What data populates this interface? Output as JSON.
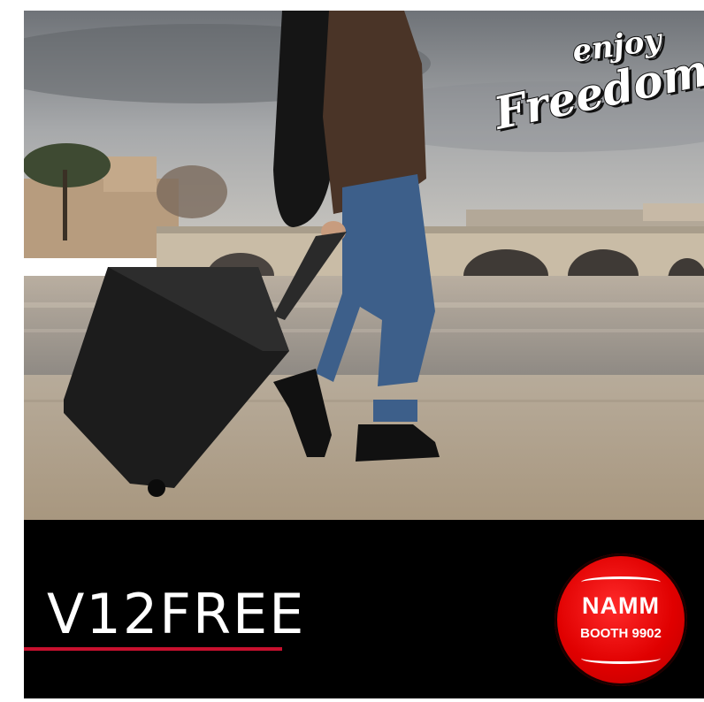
{
  "promo": {
    "product_name": "V12FREE",
    "accent_color": "#c8102e",
    "background_color": "#000000"
  },
  "logo": {
    "line1": "enjoy",
    "line2": "Freedom"
  },
  "badge": {
    "title": "NAMM",
    "subtitle": "BOOTH 9902",
    "color": "#e00000"
  }
}
